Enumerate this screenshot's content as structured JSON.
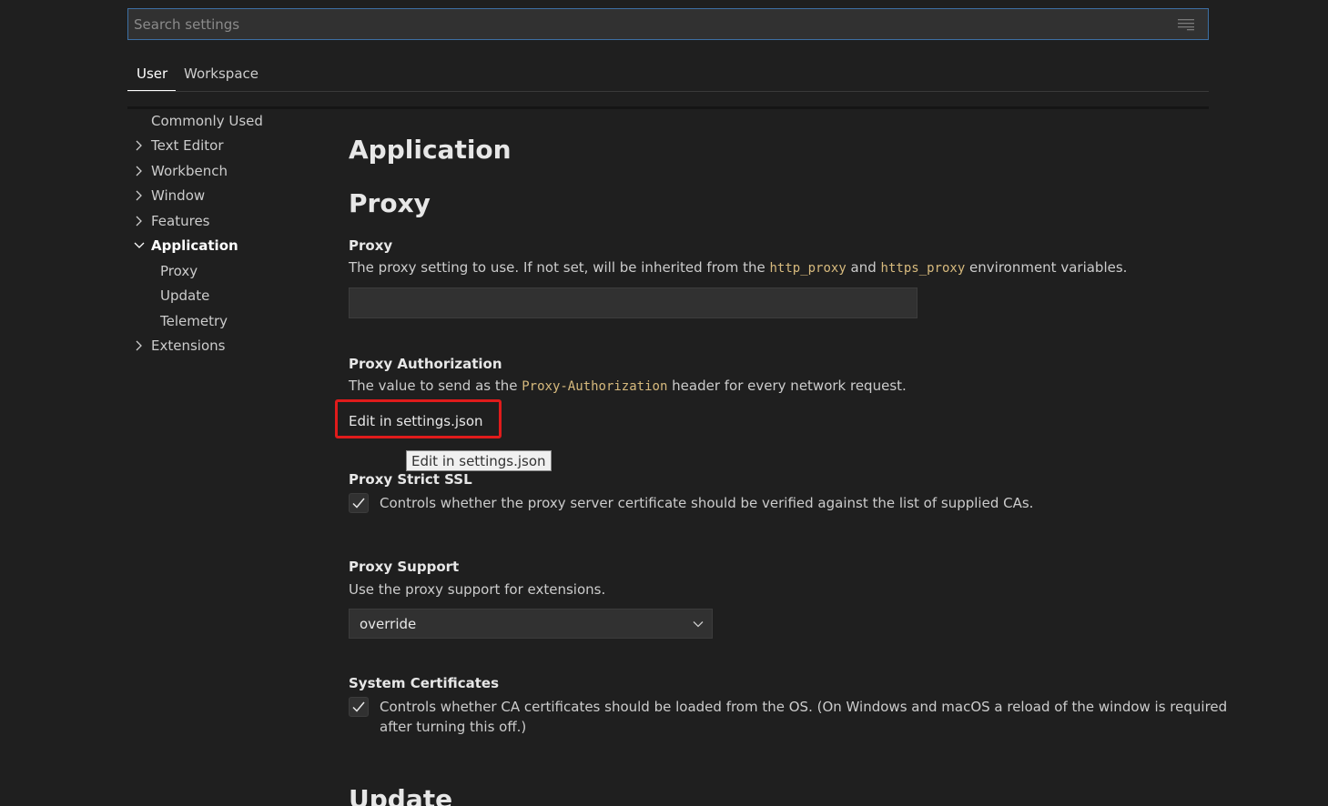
{
  "search": {
    "placeholder": "Search settings"
  },
  "tabs": [
    {
      "label": "User"
    },
    {
      "label": "Workspace"
    }
  ],
  "tree": {
    "items": [
      {
        "label": "Commonly Used"
      },
      {
        "label": "Text Editor"
      },
      {
        "label": "Workbench"
      },
      {
        "label": "Window"
      },
      {
        "label": "Features"
      },
      {
        "label": "Application"
      },
      {
        "label": "Proxy"
      },
      {
        "label": "Update"
      },
      {
        "label": "Telemetry"
      },
      {
        "label": "Extensions"
      }
    ]
  },
  "content": {
    "section_title": "Application",
    "subsection_title": "Proxy",
    "next_section_title": "Update",
    "proxy": {
      "title": "Proxy",
      "desc_before": "The proxy setting to use. If not set, will be inherited from the ",
      "code1": "http_proxy",
      "desc_mid": " and ",
      "code2": "https_proxy",
      "desc_after": " environment variables.",
      "value": ""
    },
    "proxy_authorization": {
      "title": "Proxy Authorization",
      "desc_before": "The value to send as the ",
      "code": "Proxy-Authorization",
      "desc_after": " header for every network request.",
      "edit_link": "Edit in settings.json",
      "tooltip": "Edit in settings.json"
    },
    "proxy_strict_ssl": {
      "title": "Proxy Strict SSL",
      "checked": true,
      "desc": "Controls whether the proxy server certificate should be verified against the list of supplied CAs."
    },
    "proxy_support": {
      "title": "Proxy Support",
      "desc": "Use the proxy support for extensions.",
      "selected": "override"
    },
    "system_certificates": {
      "title": "System Certificates",
      "checked": true,
      "desc_line1": "Controls whether CA certificates should be loaded from the OS. (On Windows and macOS a reload of the window is required",
      "desc_line2": "after turning this off.)"
    }
  },
  "colors": {
    "background": "#1f1f1f",
    "code_accent": "#d7ba7d",
    "highlight": "#e01b1b",
    "focus_border": "#3d6fa3"
  }
}
